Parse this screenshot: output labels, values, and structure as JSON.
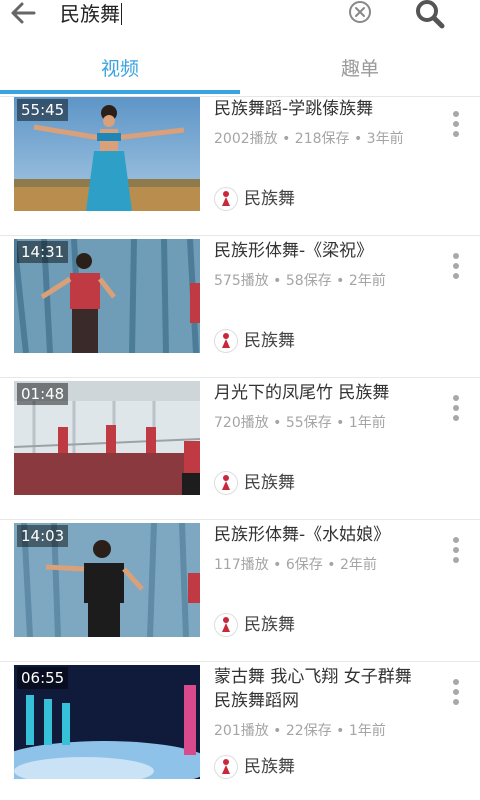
{
  "search": {
    "query": "民族舞"
  },
  "tabs": [
    {
      "label": "视频",
      "active": true
    },
    {
      "label": "趣单",
      "active": false
    }
  ],
  "accent_color": "#3aa3e0",
  "videos": [
    {
      "duration": "55:45",
      "title": "民族舞蹈-学跳傣族舞",
      "meta": "2002播放 • 218保存 • 3年前",
      "channel": "民族舞"
    },
    {
      "duration": "14:31",
      "title": "民族形体舞-《梁祝》",
      "meta": "575播放 • 58保存 • 2年前",
      "channel": "民族舞"
    },
    {
      "duration": "01:48",
      "title": "月光下的凤尾竹 民族舞",
      "meta": "720播放 • 55保存 • 1年前",
      "channel": "民族舞"
    },
    {
      "duration": "14:03",
      "title": "民族形体舞-《水姑娘》",
      "meta": "117播放 • 6保存 • 2年前",
      "channel": "民族舞"
    },
    {
      "duration": "06:55",
      "title": "蒙古舞 我心飞翔 女子群舞 民族舞蹈网",
      "meta": "201播放 • 22保存 • 1年前",
      "channel": "民族舞"
    }
  ]
}
